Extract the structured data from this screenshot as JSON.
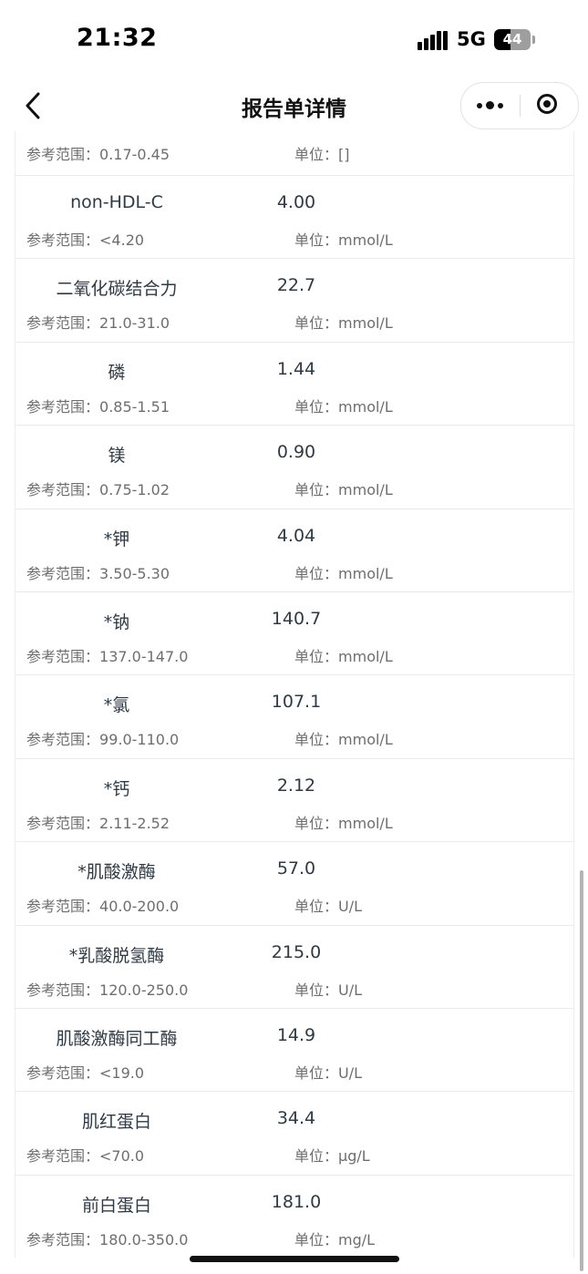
{
  "status_bar": {
    "time": "21:32",
    "network": "5G",
    "battery_level": "44",
    "battery_fraction": 0.44
  },
  "nav": {
    "title": "报告单详情",
    "icons": {
      "back": "chevron-left-icon",
      "more": "more-dots-icon",
      "close": "mini-program-close-icon"
    }
  },
  "labels": {
    "ref_prefix": "参考范围：",
    "unit_prefix": "单位："
  },
  "partial_item": {
    "ref": "0.17-0.45",
    "unit": "[]"
  },
  "items": [
    {
      "name": "non-HDL-C",
      "value": "4.00",
      "ref": "<4.20",
      "unit": "mmol/L"
    },
    {
      "name": "二氧化碳结合力",
      "value": "22.7",
      "ref": "21.0-31.0",
      "unit": "mmol/L"
    },
    {
      "name": "磷",
      "value": "1.44",
      "ref": "0.85-1.51",
      "unit": "mmol/L"
    },
    {
      "name": "镁",
      "value": "0.90",
      "ref": "0.75-1.02",
      "unit": "mmol/L"
    },
    {
      "name": "*钾",
      "value": "4.04",
      "ref": "3.50-5.30",
      "unit": "mmol/L"
    },
    {
      "name": "*钠",
      "value": "140.7",
      "ref": "137.0-147.0",
      "unit": "mmol/L"
    },
    {
      "name": "*氯",
      "value": "107.1",
      "ref": "99.0-110.0",
      "unit": "mmol/L"
    },
    {
      "name": "*钙",
      "value": "2.12",
      "ref": "2.11-2.52",
      "unit": "mmol/L"
    },
    {
      "name": "*肌酸激酶",
      "value": "57.0",
      "ref": "40.0-200.0",
      "unit": "U/L"
    },
    {
      "name": "*乳酸脱氢酶",
      "value": "215.0",
      "ref": "120.0-250.0",
      "unit": "U/L"
    },
    {
      "name": "肌酸激酶同工酶",
      "value": "14.9",
      "ref": "<19.0",
      "unit": "U/L"
    },
    {
      "name": "肌红蛋白",
      "value": "34.4",
      "ref": "<70.0",
      "unit": "μg/L"
    },
    {
      "name": "前白蛋白",
      "value": "181.0",
      "ref": "180.0-350.0",
      "unit": "mg/L"
    }
  ]
}
